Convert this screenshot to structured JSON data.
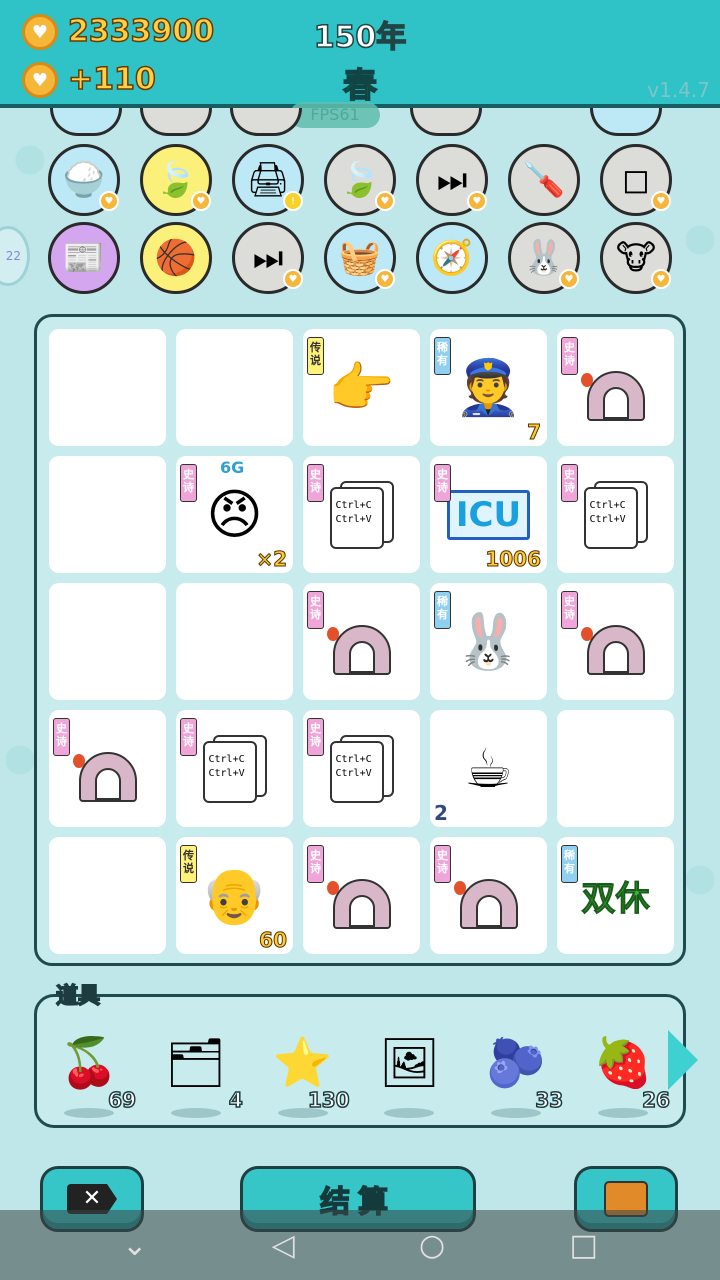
{
  "top": {
    "coins": "2333900",
    "income": "+110",
    "year": "150年",
    "season": "春",
    "version": "v1.4.7",
    "fps": "FPS61"
  },
  "icons_row1": [
    "rice-bowl",
    "leaf",
    "printer",
    "leaf",
    "skip-forward",
    "screwdriver",
    "sugar-cubes"
  ],
  "icons_row2": [
    "time-magazine",
    "basketballs",
    "skip-forward",
    "fruit-basket",
    "compass",
    "rabbit",
    "cows"
  ],
  "grid": {
    "cells": [
      {
        "tag": "",
        "item": "",
        "count": ""
      },
      {
        "tag": "",
        "item": "",
        "count": ""
      },
      {
        "tag": "传说",
        "item": "pointing-hand",
        "count": ""
      },
      {
        "tag": "稀有",
        "item": "police-face",
        "count": "7"
      },
      {
        "tag": "史诗",
        "item": "tent",
        "count": ""
      },
      {
        "tag": "",
        "item": "",
        "count": ""
      },
      {
        "tag": "史诗",
        "item": "grumpy-man",
        "count": "×2",
        "top": "6G"
      },
      {
        "tag": "史诗",
        "item": "ctrl-cv",
        "count": ""
      },
      {
        "tag": "史诗",
        "item": "icu",
        "count": "1006"
      },
      {
        "tag": "史诗",
        "item": "ctrl-cv",
        "count": ""
      },
      {
        "tag": "",
        "item": "",
        "count": ""
      },
      {
        "tag": "",
        "item": "",
        "count": ""
      },
      {
        "tag": "史诗",
        "item": "tent",
        "count": ""
      },
      {
        "tag": "稀有",
        "item": "rabbit",
        "count": ""
      },
      {
        "tag": "史诗",
        "item": "tent",
        "count": ""
      },
      {
        "tag": "史诗",
        "item": "tent",
        "count": ""
      },
      {
        "tag": "史诗",
        "item": "ctrl-cv",
        "count": ""
      },
      {
        "tag": "史诗",
        "item": "ctrl-cv",
        "count": ""
      },
      {
        "tag": "",
        "item": "coffee",
        "count": "2"
      },
      {
        "tag": "",
        "item": "",
        "count": ""
      },
      {
        "tag": "",
        "item": "",
        "count": ""
      },
      {
        "tag": "传说",
        "item": "old-man",
        "count": "60"
      },
      {
        "tag": "史诗",
        "item": "tent",
        "count": ""
      },
      {
        "tag": "史诗",
        "item": "tent",
        "count": ""
      },
      {
        "tag": "稀有",
        "item": "shuangxiu",
        "count": ""
      }
    ],
    "ctrl_text": [
      "Ctrl+C",
      "Ctrl+V"
    ],
    "icu_text": "ICU",
    "shuangxiu_text": "双休"
  },
  "items": {
    "label": "道具",
    "list": [
      {
        "name": "lychee",
        "count": "69"
      },
      {
        "name": "rare-cards",
        "count": "4"
      },
      {
        "name": "star",
        "count": "130"
      },
      {
        "name": "watermelon-frame",
        "count": ""
      },
      {
        "name": "blueberry",
        "count": "33"
      },
      {
        "name": "strawberry",
        "count": "26"
      }
    ]
  },
  "buttons": {
    "settle": "结算"
  }
}
